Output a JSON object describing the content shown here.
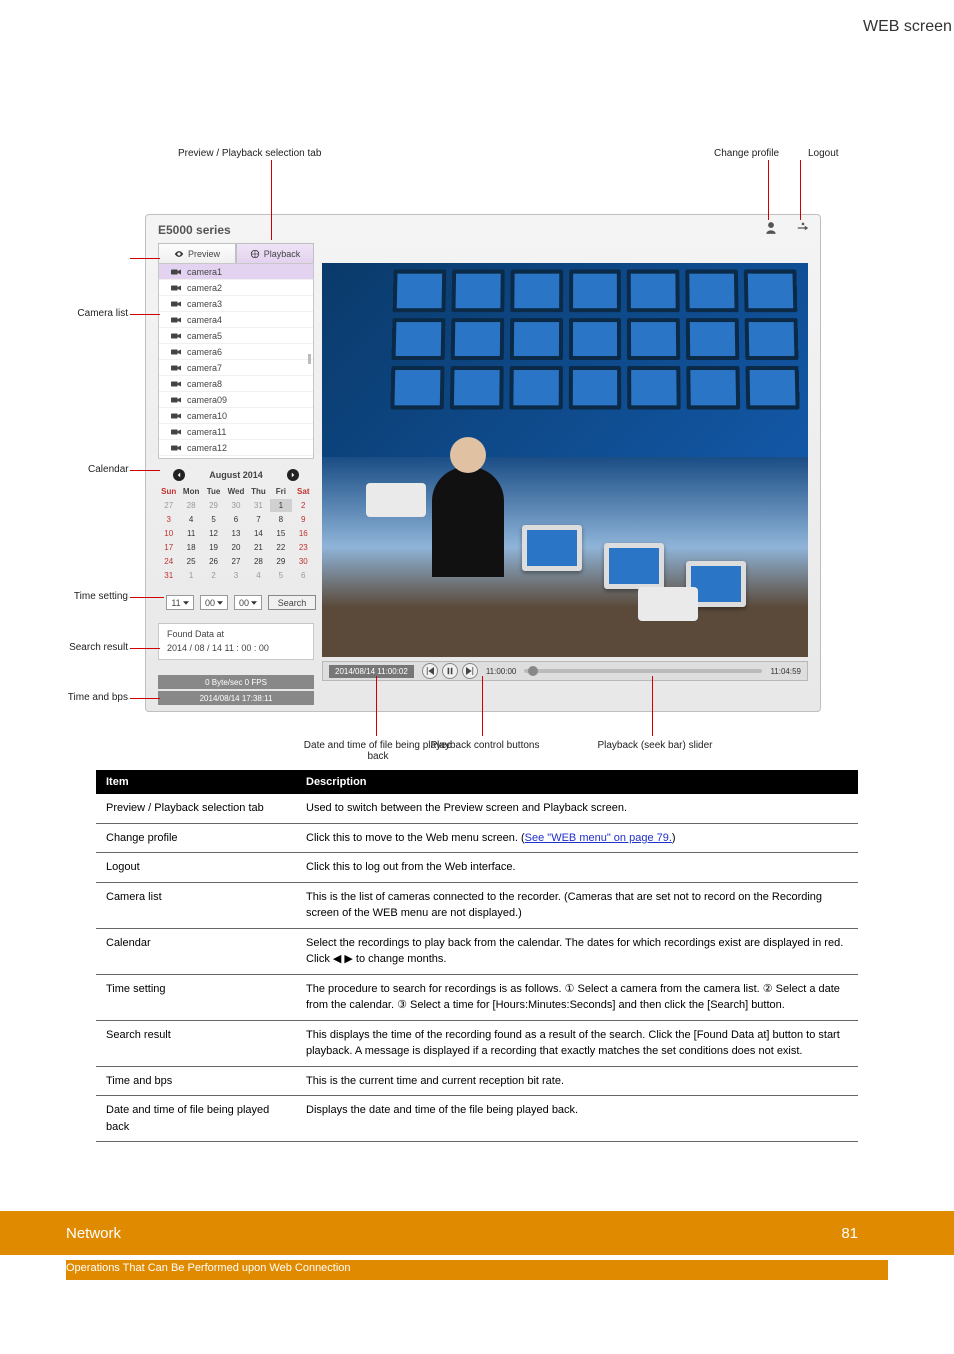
{
  "page_label_top_right": "WEB screen",
  "annotations": {
    "tab_select": "Preview / Playback selection tab",
    "change_profile": "Change profile",
    "logout": "Logout",
    "camera_list": "Camera list",
    "calendar": "Calendar",
    "time_setting": "Time setting",
    "search_result": "Search result",
    "time_and_bps": "Time and bps",
    "playback_date_time": "Date and time of file being played back",
    "playback_buttons": "Playback control buttons",
    "playback_slider": "Playback (seek bar) slider"
  },
  "app": {
    "title": "E5000 series",
    "tabs": {
      "preview": "Preview",
      "playback": "Playback"
    },
    "cameras": [
      "camera1",
      "camera2",
      "camera3",
      "camera4",
      "camera5",
      "camera6",
      "camera7",
      "camera8",
      "camera09",
      "camera10",
      "camera11",
      "camera12"
    ],
    "calendar": {
      "title": "August 2014",
      "dow": [
        "Sun",
        "Mon",
        "Tue",
        "Wed",
        "Thu",
        "Fri",
        "Sat"
      ],
      "grid": [
        [
          {
            "d": "27",
            "t": "out"
          },
          {
            "d": "28",
            "t": "out"
          },
          {
            "d": "29",
            "t": "out"
          },
          {
            "d": "30",
            "t": "out"
          },
          {
            "d": "31",
            "t": "out"
          },
          {
            "d": "1",
            "t": "sel"
          },
          {
            "d": "2",
            "t": "red"
          }
        ],
        [
          {
            "d": "3",
            "t": "red"
          },
          {
            "d": "4",
            "t": "cur"
          },
          {
            "d": "5",
            "t": "cur"
          },
          {
            "d": "6",
            "t": "cur"
          },
          {
            "d": "7",
            "t": "cur"
          },
          {
            "d": "8",
            "t": "cur"
          },
          {
            "d": "9",
            "t": "red"
          }
        ],
        [
          {
            "d": "10",
            "t": "red"
          },
          {
            "d": "11",
            "t": "cur"
          },
          {
            "d": "12",
            "t": "cur"
          },
          {
            "d": "13",
            "t": "cur"
          },
          {
            "d": "14",
            "t": "cur"
          },
          {
            "d": "15",
            "t": "cur"
          },
          {
            "d": "16",
            "t": "red"
          }
        ],
        [
          {
            "d": "17",
            "t": "red"
          },
          {
            "d": "18",
            "t": "cur"
          },
          {
            "d": "19",
            "t": "cur"
          },
          {
            "d": "20",
            "t": "cur"
          },
          {
            "d": "21",
            "t": "cur"
          },
          {
            "d": "22",
            "t": "cur"
          },
          {
            "d": "23",
            "t": "red"
          }
        ],
        [
          {
            "d": "24",
            "t": "red"
          },
          {
            "d": "25",
            "t": "cur"
          },
          {
            "d": "26",
            "t": "cur"
          },
          {
            "d": "27",
            "t": "cur"
          },
          {
            "d": "28",
            "t": "cur"
          },
          {
            "d": "29",
            "t": "cur"
          },
          {
            "d": "30",
            "t": "red"
          }
        ],
        [
          {
            "d": "31",
            "t": "red"
          },
          {
            "d": "1",
            "t": "out"
          },
          {
            "d": "2",
            "t": "out"
          },
          {
            "d": "3",
            "t": "out"
          },
          {
            "d": "4",
            "t": "out"
          },
          {
            "d": "5",
            "t": "out"
          },
          {
            "d": "6",
            "t": "out"
          }
        ]
      ]
    },
    "time": {
      "hh": "11",
      "mm": "00",
      "ss": "00",
      "search": "Search"
    },
    "found": {
      "label": "Found Data at",
      "value": "2014 / 08 / 14   11 : 00 : 00"
    },
    "bytes_bar": "0 Byte/sec  0 FPS",
    "date_bar": "2014/08/14 17:38:11",
    "playback": {
      "ts": "2014/08/14 11:00:02",
      "start": "11:00:00",
      "end": "11:04:59"
    }
  },
  "table": {
    "head": {
      "item": "Item",
      "desc": "Description"
    },
    "rows": [
      {
        "item": "Preview / Playback selection tab",
        "desc_plain": "Used to switch between the Preview screen and Playback screen.",
        "desc_link": null
      },
      {
        "item": "Change profile",
        "desc_plain": "Click this to move to the Web menu screen. (",
        "desc_link": "See \"WEB menu\" on page 79.",
        "desc_after": ")"
      },
      {
        "item": "Logout",
        "desc_plain": "Click this to log out from the Web interface.",
        "desc_link": null
      },
      {
        "item": "Camera list",
        "desc_plain": "This is the list of cameras connected to the recorder. (Cameras that are set not to record on the Recording screen of the WEB menu are not displayed.)",
        "desc_link": null
      },
      {
        "item": "Calendar",
        "desc_plain": "Select the recordings to play back from the calendar. The dates for which recordings exist are displayed in red. Click ◀ ▶ to change months.",
        "desc_link": null
      },
      {
        "item": "Time setting",
        "desc_plain": "The procedure to search for recordings is as follows. ① Select a camera from the camera list. ② Select a date from the calendar. ③ Select a time for [Hours:Minutes:Seconds] and then click the [Search] button.",
        "desc_link": null
      },
      {
        "item": "Search result",
        "desc_plain": "This displays the time of the recording found as a result of the search. Click the [Found Data at] button to start playback. A message is displayed if a recording that exactly matches the set conditions does not exist.",
        "desc_link": null
      },
      {
        "item": "Time and bps",
        "desc_plain": "This is the current time and current reception bit rate.",
        "desc_link": null
      },
      {
        "item": "Date and time of file being played back",
        "desc_plain": "Displays the date and time of the file being played back.",
        "desc_link": null
      }
    ]
  },
  "footer": {
    "title": "Network",
    "page": "81",
    "sub": "Operations That Can Be Performed upon Web Connection"
  }
}
